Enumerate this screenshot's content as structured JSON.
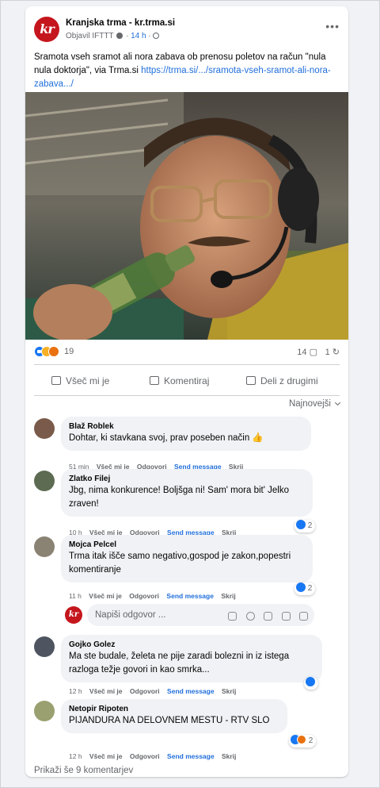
{
  "post": {
    "page_name": "Kranjska trma - kr.trma.si",
    "logo_text": "kr",
    "author": "Objavil IFTTT",
    "time": "14 h",
    "text": "Sramota vseh sramot ali nora zabava ob prenosu poletov na račun \"nula nula doktorja\", via Trma.si ",
    "link": "https://trma.si/.../sramota-vseh-sramot-ali-nora-zabava.../",
    "image_alt": "Moški z naglavnimi slušalkami in mikrofonom, očali in brki, pije iz steklenice"
  },
  "stats": {
    "reaction_count": "19",
    "comment_count": "14",
    "share_count": "1"
  },
  "actions": {
    "like": "Všeč mi je",
    "comment": "Komentiraj",
    "share": "Deli z drugimi"
  },
  "sort_label": "Najnovejši",
  "comment_actions": {
    "like": "Všeč mi je",
    "reply": "Odgovori",
    "send": "Send message",
    "hide": "Skrij"
  },
  "comments": [
    {
      "name": "Blaž Roblek",
      "text": "Dohtar, ki stavkana svoj, prav poseben način 👍",
      "time": "51 min",
      "avatar_color": "#7a5a4a"
    },
    {
      "name": "Zlatko Filej",
      "text": "Jbg, nima konkurence! Boljšga ni! Sam' mora bit' Jelko zraven!",
      "time": "10 h",
      "reactions": "2",
      "avatar_color": "#5d6b52"
    },
    {
      "name": "Mojca Pelcel",
      "text": "Trma itak išče samo negativo,gospod je zakon,popestri komentiranje",
      "time": "11 h",
      "reactions": "2",
      "avatar_color": "#8a8272"
    },
    {
      "name": "Gojko Golez",
      "text": "Ma ste budale, želeta ne pije zaradi bolezni in iz istega razloga težje govori in kao smrka...",
      "time": "12 h",
      "avatar_color": "#4f5560"
    },
    {
      "name": "Netopir Ripoten",
      "text": "PIJANDURA NA DELOVNEM MESTU - RTV SLO",
      "time": "12 h",
      "reactions": "2",
      "avatar_color": "#9aa070"
    }
  ],
  "reply": {
    "placeholder": "Napiši odgovor ...",
    "logo_text": "kr"
  },
  "more_comments": "Prikaži še 9 komentarjev"
}
